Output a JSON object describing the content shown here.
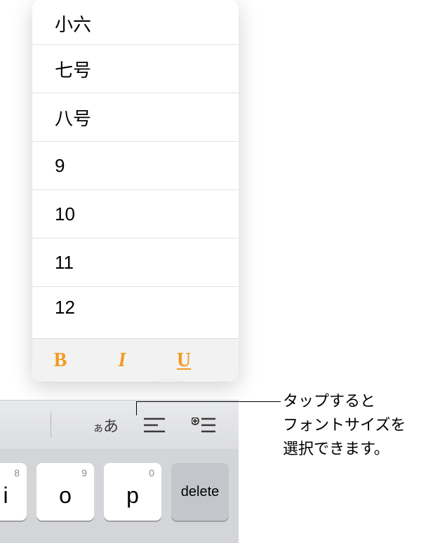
{
  "sizeList": {
    "items": [
      "小六",
      "七号",
      "八号",
      "9",
      "10",
      "11",
      "12"
    ]
  },
  "formatBar": {
    "bold": "B",
    "italic": "I",
    "underline": "U"
  },
  "shortcutBar": {
    "aa_small": "ぁ",
    "aa_large": "あ"
  },
  "keyboard": {
    "keys": [
      {
        "hint": "8",
        "main": "i",
        "partial": true
      },
      {
        "hint": "9",
        "main": "o"
      },
      {
        "hint": "0",
        "main": "p"
      },
      {
        "main": "delete",
        "type": "delete"
      }
    ]
  },
  "callout": {
    "line1": "タップすると",
    "line2": "フォントサイズを",
    "line3": "選択できます。"
  }
}
